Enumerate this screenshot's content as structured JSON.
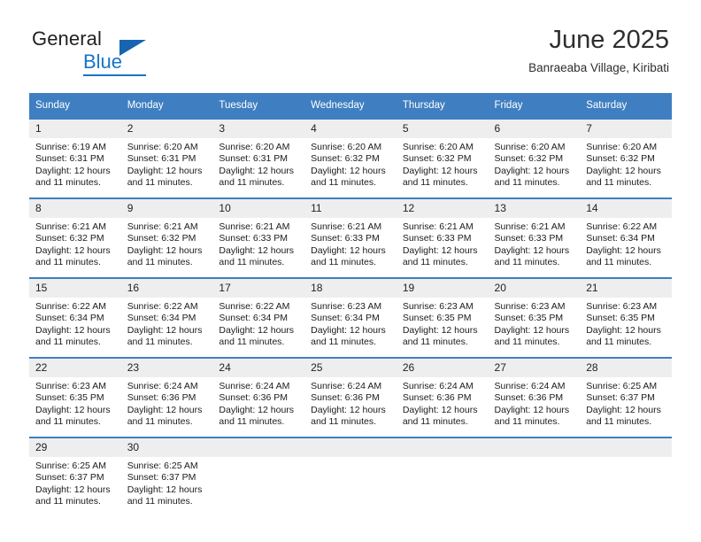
{
  "brand": {
    "name_part1": "General",
    "name_part2": "Blue",
    "logo_icon": "triangle-icon"
  },
  "header": {
    "title": "June 2025",
    "subtitle": "Banraeaba Village, Kiribati"
  },
  "colors": {
    "header_blue": "#3f7fc1",
    "brand_blue": "#1675c8",
    "daynum_background": "#eeeeee",
    "text": "#1b1b1b"
  },
  "calendar": {
    "weekday_headers": [
      "Sunday",
      "Monday",
      "Tuesday",
      "Wednesday",
      "Thursday",
      "Friday",
      "Saturday"
    ],
    "weeks": [
      [
        {
          "day": "1",
          "sunrise": "Sunrise: 6:19 AM",
          "sunset": "Sunset: 6:31 PM",
          "daylight_line1": "Daylight: 12 hours",
          "daylight_line2": "and 11 minutes."
        },
        {
          "day": "2",
          "sunrise": "Sunrise: 6:20 AM",
          "sunset": "Sunset: 6:31 PM",
          "daylight_line1": "Daylight: 12 hours",
          "daylight_line2": "and 11 minutes."
        },
        {
          "day": "3",
          "sunrise": "Sunrise: 6:20 AM",
          "sunset": "Sunset: 6:31 PM",
          "daylight_line1": "Daylight: 12 hours",
          "daylight_line2": "and 11 minutes."
        },
        {
          "day": "4",
          "sunrise": "Sunrise: 6:20 AM",
          "sunset": "Sunset: 6:32 PM",
          "daylight_line1": "Daylight: 12 hours",
          "daylight_line2": "and 11 minutes."
        },
        {
          "day": "5",
          "sunrise": "Sunrise: 6:20 AM",
          "sunset": "Sunset: 6:32 PM",
          "daylight_line1": "Daylight: 12 hours",
          "daylight_line2": "and 11 minutes."
        },
        {
          "day": "6",
          "sunrise": "Sunrise: 6:20 AM",
          "sunset": "Sunset: 6:32 PM",
          "daylight_line1": "Daylight: 12 hours",
          "daylight_line2": "and 11 minutes."
        },
        {
          "day": "7",
          "sunrise": "Sunrise: 6:20 AM",
          "sunset": "Sunset: 6:32 PM",
          "daylight_line1": "Daylight: 12 hours",
          "daylight_line2": "and 11 minutes."
        }
      ],
      [
        {
          "day": "8",
          "sunrise": "Sunrise: 6:21 AM",
          "sunset": "Sunset: 6:32 PM",
          "daylight_line1": "Daylight: 12 hours",
          "daylight_line2": "and 11 minutes."
        },
        {
          "day": "9",
          "sunrise": "Sunrise: 6:21 AM",
          "sunset": "Sunset: 6:32 PM",
          "daylight_line1": "Daylight: 12 hours",
          "daylight_line2": "and 11 minutes."
        },
        {
          "day": "10",
          "sunrise": "Sunrise: 6:21 AM",
          "sunset": "Sunset: 6:33 PM",
          "daylight_line1": "Daylight: 12 hours",
          "daylight_line2": "and 11 minutes."
        },
        {
          "day": "11",
          "sunrise": "Sunrise: 6:21 AM",
          "sunset": "Sunset: 6:33 PM",
          "daylight_line1": "Daylight: 12 hours",
          "daylight_line2": "and 11 minutes."
        },
        {
          "day": "12",
          "sunrise": "Sunrise: 6:21 AM",
          "sunset": "Sunset: 6:33 PM",
          "daylight_line1": "Daylight: 12 hours",
          "daylight_line2": "and 11 minutes."
        },
        {
          "day": "13",
          "sunrise": "Sunrise: 6:21 AM",
          "sunset": "Sunset: 6:33 PM",
          "daylight_line1": "Daylight: 12 hours",
          "daylight_line2": "and 11 minutes."
        },
        {
          "day": "14",
          "sunrise": "Sunrise: 6:22 AM",
          "sunset": "Sunset: 6:34 PM",
          "daylight_line1": "Daylight: 12 hours",
          "daylight_line2": "and 11 minutes."
        }
      ],
      [
        {
          "day": "15",
          "sunrise": "Sunrise: 6:22 AM",
          "sunset": "Sunset: 6:34 PM",
          "daylight_line1": "Daylight: 12 hours",
          "daylight_line2": "and 11 minutes."
        },
        {
          "day": "16",
          "sunrise": "Sunrise: 6:22 AM",
          "sunset": "Sunset: 6:34 PM",
          "daylight_line1": "Daylight: 12 hours",
          "daylight_line2": "and 11 minutes."
        },
        {
          "day": "17",
          "sunrise": "Sunrise: 6:22 AM",
          "sunset": "Sunset: 6:34 PM",
          "daylight_line1": "Daylight: 12 hours",
          "daylight_line2": "and 11 minutes."
        },
        {
          "day": "18",
          "sunrise": "Sunrise: 6:23 AM",
          "sunset": "Sunset: 6:34 PM",
          "daylight_line1": "Daylight: 12 hours",
          "daylight_line2": "and 11 minutes."
        },
        {
          "day": "19",
          "sunrise": "Sunrise: 6:23 AM",
          "sunset": "Sunset: 6:35 PM",
          "daylight_line1": "Daylight: 12 hours",
          "daylight_line2": "and 11 minutes."
        },
        {
          "day": "20",
          "sunrise": "Sunrise: 6:23 AM",
          "sunset": "Sunset: 6:35 PM",
          "daylight_line1": "Daylight: 12 hours",
          "daylight_line2": "and 11 minutes."
        },
        {
          "day": "21",
          "sunrise": "Sunrise: 6:23 AM",
          "sunset": "Sunset: 6:35 PM",
          "daylight_line1": "Daylight: 12 hours",
          "daylight_line2": "and 11 minutes."
        }
      ],
      [
        {
          "day": "22",
          "sunrise": "Sunrise: 6:23 AM",
          "sunset": "Sunset: 6:35 PM",
          "daylight_line1": "Daylight: 12 hours",
          "daylight_line2": "and 11 minutes."
        },
        {
          "day": "23",
          "sunrise": "Sunrise: 6:24 AM",
          "sunset": "Sunset: 6:36 PM",
          "daylight_line1": "Daylight: 12 hours",
          "daylight_line2": "and 11 minutes."
        },
        {
          "day": "24",
          "sunrise": "Sunrise: 6:24 AM",
          "sunset": "Sunset: 6:36 PM",
          "daylight_line1": "Daylight: 12 hours",
          "daylight_line2": "and 11 minutes."
        },
        {
          "day": "25",
          "sunrise": "Sunrise: 6:24 AM",
          "sunset": "Sunset: 6:36 PM",
          "daylight_line1": "Daylight: 12 hours",
          "daylight_line2": "and 11 minutes."
        },
        {
          "day": "26",
          "sunrise": "Sunrise: 6:24 AM",
          "sunset": "Sunset: 6:36 PM",
          "daylight_line1": "Daylight: 12 hours",
          "daylight_line2": "and 11 minutes."
        },
        {
          "day": "27",
          "sunrise": "Sunrise: 6:24 AM",
          "sunset": "Sunset: 6:36 PM",
          "daylight_line1": "Daylight: 12 hours",
          "daylight_line2": "and 11 minutes."
        },
        {
          "day": "28",
          "sunrise": "Sunrise: 6:25 AM",
          "sunset": "Sunset: 6:37 PM",
          "daylight_line1": "Daylight: 12 hours",
          "daylight_line2": "and 11 minutes."
        }
      ],
      [
        {
          "day": "29",
          "sunrise": "Sunrise: 6:25 AM",
          "sunset": "Sunset: 6:37 PM",
          "daylight_line1": "Daylight: 12 hours",
          "daylight_line2": "and 11 minutes."
        },
        {
          "day": "30",
          "sunrise": "Sunrise: 6:25 AM",
          "sunset": "Sunset: 6:37 PM",
          "daylight_line1": "Daylight: 12 hours",
          "daylight_line2": "and 11 minutes."
        },
        {
          "day": "",
          "sunrise": "",
          "sunset": "",
          "daylight_line1": "",
          "daylight_line2": ""
        },
        {
          "day": "",
          "sunrise": "",
          "sunset": "",
          "daylight_line1": "",
          "daylight_line2": ""
        },
        {
          "day": "",
          "sunrise": "",
          "sunset": "",
          "daylight_line1": "",
          "daylight_line2": ""
        },
        {
          "day": "",
          "sunrise": "",
          "sunset": "",
          "daylight_line1": "",
          "daylight_line2": ""
        },
        {
          "day": "",
          "sunrise": "",
          "sunset": "",
          "daylight_line1": "",
          "daylight_line2": ""
        }
      ]
    ]
  }
}
